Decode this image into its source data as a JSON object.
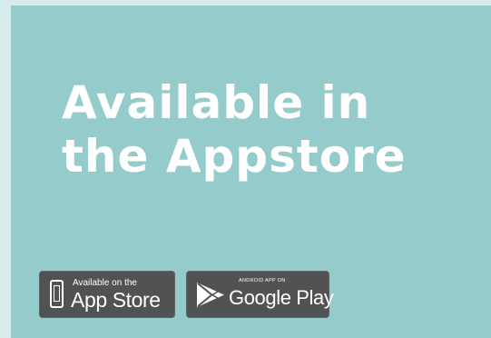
{
  "headline": {
    "line1": "Available in",
    "line2": "the Appstore"
  },
  "badges": {
    "apple": {
      "small_label": "Available on the",
      "big_label": "App Store",
      "icon": "iphone-icon"
    },
    "google": {
      "small_label": "ANDROID APP ON",
      "big_label": "Google Play",
      "icon": "google-play-icon"
    }
  },
  "colors": {
    "panel_background": "#96cbcc",
    "outer_background": "#d9eced",
    "badge_background": "#505254",
    "text": "#ffffff"
  }
}
